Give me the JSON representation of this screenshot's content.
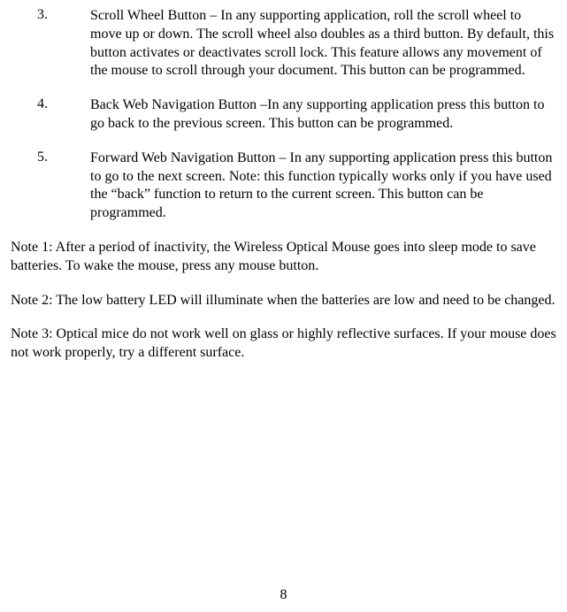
{
  "items": [
    {
      "num": "3.",
      "text": "Scroll Wheel Button – In any supporting application, roll the scroll wheel to move up or down.  The scroll wheel also doubles as a third button.  By default, this button activates or deactivates scroll lock. This feature allows any movement of the mouse to scroll through your document.  This button can be programmed."
    },
    {
      "num": "4.",
      "text": "Back Web Navigation Button –In any supporting application press this button to go back to the previous screen. This button can be programmed."
    },
    {
      "num": "5.",
      "text": "Forward Web Navigation Button – In any supporting application press this button to go to the next screen. Note: this function typically works only if you have used the “back” function to return to the current screen.  This button can be programmed."
    }
  ],
  "notes": [
    "Note 1: After a period of inactivity, the Wireless Optical Mouse goes into sleep mode to save batteries. To wake the mouse, press any mouse button.",
    "Note 2: The low battery LED will illuminate when the batteries are low and need to be changed.",
    "Note 3: Optical mice do not work well on glass or highly reflective surfaces. If your mouse does not work properly, try a different surface."
  ],
  "page_number": "8"
}
